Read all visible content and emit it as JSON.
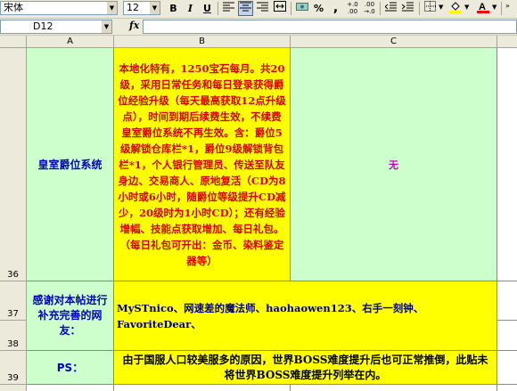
{
  "toolbar": {
    "font_name": "宋体",
    "font_size": "12",
    "bold": "B",
    "italic": "I",
    "underline": "U",
    "percent": "%",
    "comma": ",",
    "inc_decimal": "+.0\n.00",
    "dec_decimal": ".00\n→.0"
  },
  "formula_bar": {
    "name_box": "D12",
    "fx": "fx",
    "value": ""
  },
  "columns": [
    "A",
    "B",
    "C"
  ],
  "rows": {
    "r36": {
      "num": "36",
      "a": "皇室爵位系统",
      "b": "本地化特有，1250宝石每月。共20级，采用日常任务和每日登录获得爵位经验升级（每天最高获取12点升级点），时间到期后续费生效，不续费皇室爵位系统不再生效。含：爵位5级解锁仓库栏*1，爵位9级解锁背包栏*1，个人银行管理员、传送至队友身边、交易商人、原地复活（CD为8小时或6小时，随爵位等级提升CD减少，20级时为1小时CD）；还有经验增幅、技能点获取增加、每日礼包。（每日礼包可开出：金币、染料鉴定器等）",
      "c": "无"
    },
    "r37": {
      "num": "37"
    },
    "r38": {
      "num": "38"
    },
    "r37_38": {
      "a": "感谢对本帖进行补充完善的网友：",
      "b": "MySTnico、网速差的魔法师、haohaowen123、右手一刻钟、FavoriteDear、"
    },
    "r39": {
      "num": "39",
      "a": "PS：",
      "b": "由于国服人口较美服多的原因，世界BOSS难度提升后也可正常推倒，此贴未将世界BOSS难度提升列举在内。"
    }
  },
  "colors": {
    "green_fill": "#ccffcc",
    "yellow_fill": "#ffff00",
    "red_text": "#dd0000",
    "blue_text": "#0000cc",
    "purple_text": "#cc00cc"
  }
}
